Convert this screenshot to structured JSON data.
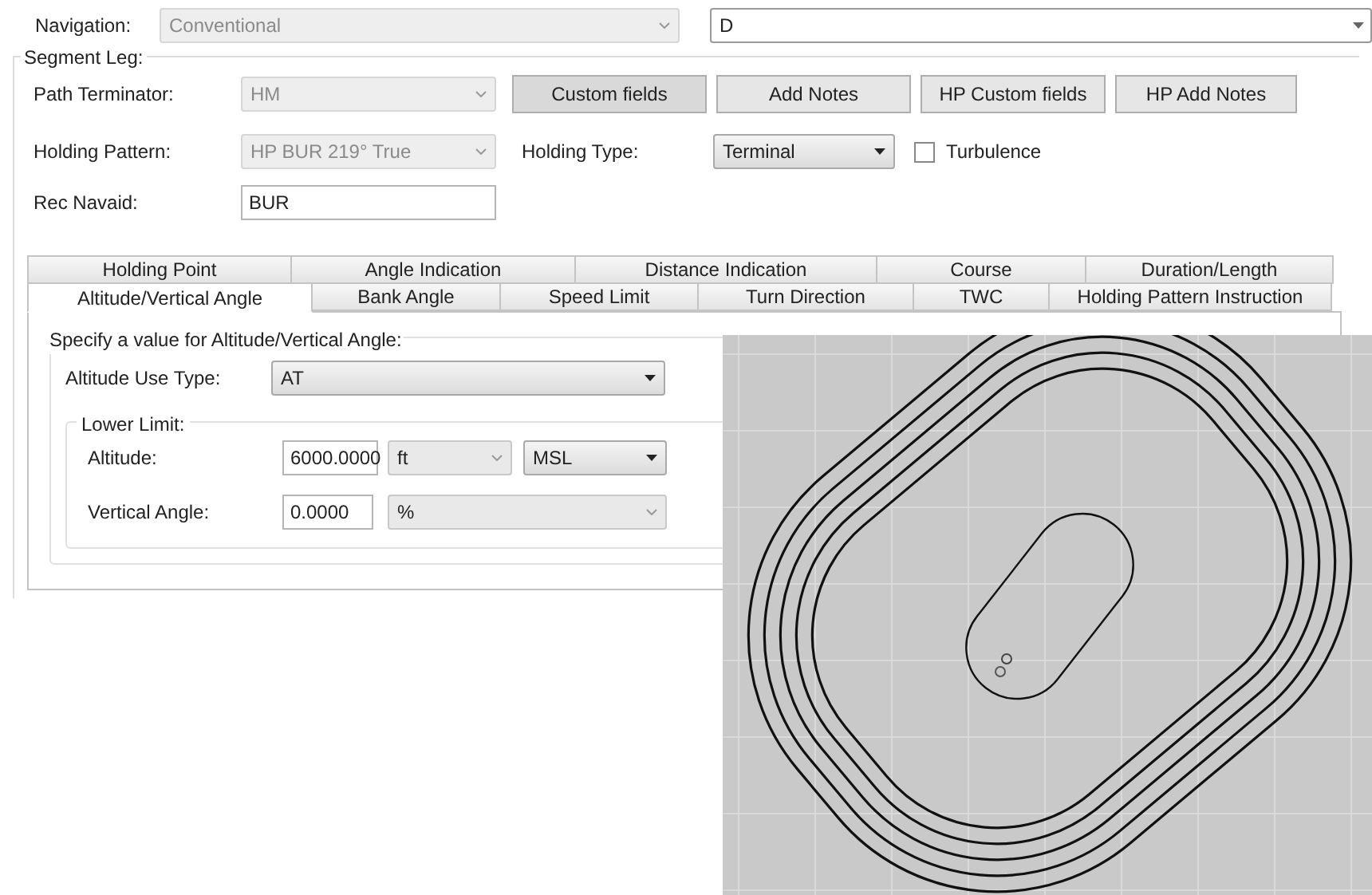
{
  "navigation": {
    "label": "Navigation:",
    "value": "Conventional",
    "disabled": true,
    "second_value": "D"
  },
  "segment_leg": {
    "title": "Segment Leg:",
    "path_terminator": {
      "label": "Path Terminator:",
      "value": "HM",
      "disabled": true
    },
    "buttons": [
      "Custom fields",
      "Add Notes",
      "HP Custom fields",
      "HP Add Notes"
    ],
    "holding_pattern": {
      "label": "Holding Pattern:",
      "value": "HP BUR 219° True",
      "disabled": true
    },
    "holding_type": {
      "label": "Holding Type:",
      "value": "Terminal"
    },
    "turbulence": {
      "label": "Turbulence",
      "checked": false
    },
    "rec_navaid": {
      "label": "Rec Navaid:",
      "value": "BUR"
    }
  },
  "tab_rows": [
    [
      {
        "label": "Holding Point",
        "selected": false
      },
      {
        "label": "Angle Indication",
        "selected": false
      },
      {
        "label": "Distance Indication",
        "selected": false
      },
      {
        "label": "Course",
        "selected": false
      },
      {
        "label": "Duration/Length",
        "selected": false
      }
    ],
    [
      {
        "label": "Altitude/Vertical Angle",
        "selected": true
      },
      {
        "label": "Bank Angle",
        "selected": false
      },
      {
        "label": "Speed Limit",
        "selected": false
      },
      {
        "label": "Turn Direction",
        "selected": false
      },
      {
        "label": "TWC",
        "selected": false
      },
      {
        "label": "Holding Pattern Instruction",
        "selected": false
      }
    ]
  ],
  "panel": {
    "title": "Specify a value for Altitude/Vertical Angle:",
    "altitude_use_type": {
      "label": "Altitude Use Type:",
      "value": "AT"
    },
    "lower_limit": {
      "title": "Lower Limit:",
      "altitude": {
        "label": "Altitude:",
        "value": "6000.0000",
        "unit": "ft",
        "reference": "MSL"
      },
      "vertical_angle": {
        "label": "Vertical Angle:",
        "value": "0.0000",
        "unit": "%"
      }
    }
  }
}
